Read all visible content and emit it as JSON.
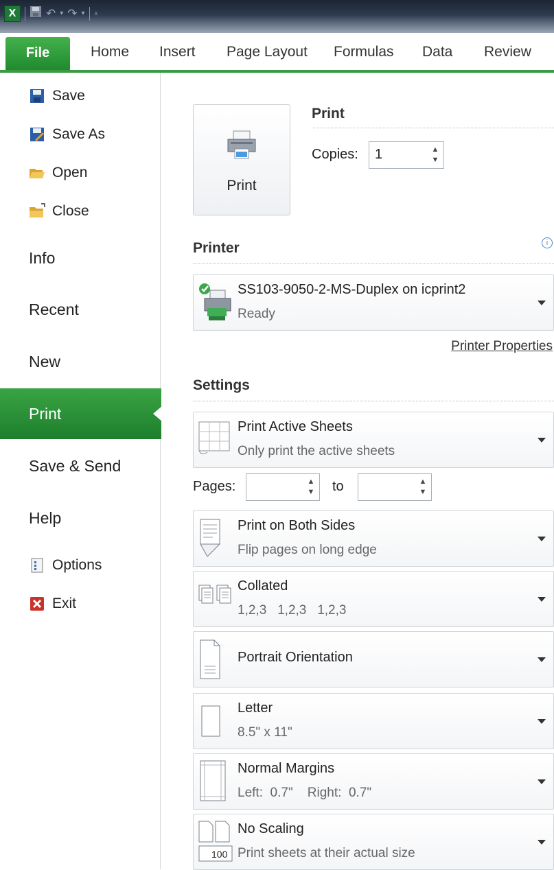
{
  "app": {
    "logo_letter": "X",
    "accent_color": "#2e9a3c",
    "qat": {
      "save_icon": "save-icon",
      "undo_icon": "undo-icon",
      "redo_icon": "redo-icon",
      "customize_icon": "customize-qat-icon"
    }
  },
  "tabs": {
    "file": "File",
    "items": [
      "Home",
      "Insert",
      "Page Layout",
      "Formulas",
      "Data",
      "Review"
    ]
  },
  "leftnav": {
    "commands": [
      {
        "label": "Save",
        "icon": "save-icon"
      },
      {
        "label": "Save As",
        "icon": "save-as-icon"
      },
      {
        "label": "Open",
        "icon": "open-folder-icon"
      },
      {
        "label": "Close",
        "icon": "close-folder-icon"
      }
    ],
    "items": [
      "Info",
      "Recent",
      "New",
      "Print",
      "Save & Send",
      "Help"
    ],
    "active": "Print",
    "bottom": [
      {
        "label": "Options",
        "icon": "options-icon"
      },
      {
        "label": "Exit",
        "icon": "exit-icon"
      }
    ]
  },
  "print": {
    "button_label": "Print",
    "section_title": "Print",
    "copies_label": "Copies:",
    "copies_value": "1"
  },
  "printer": {
    "section_title": "Printer",
    "name": "SS103-9050-2-MS-Duplex on icprint2",
    "status": "Ready",
    "properties_link": "Printer Properties"
  },
  "settings": {
    "section_title": "Settings",
    "what": {
      "title": "Print Active Sheets",
      "subtitle": "Only print the active sheets"
    },
    "pages_label": "Pages:",
    "pages_from": "",
    "to_label": "to",
    "pages_to": "",
    "sides": {
      "title": "Print on Both Sides",
      "subtitle": "Flip pages on long edge"
    },
    "collation": {
      "title": "Collated",
      "subtitle": "1,2,3   1,2,3   1,2,3"
    },
    "orientation": {
      "title": "Portrait Orientation"
    },
    "paper": {
      "title": "Letter",
      "subtitle": "8.5\" x 11\""
    },
    "margins": {
      "title": "Normal Margins",
      "subtitle": "Left:  0.7\"    Right:  0.7\""
    },
    "scaling": {
      "title": "No Scaling",
      "subtitle": "Print sheets at their actual size",
      "icon_text": "100"
    }
  }
}
